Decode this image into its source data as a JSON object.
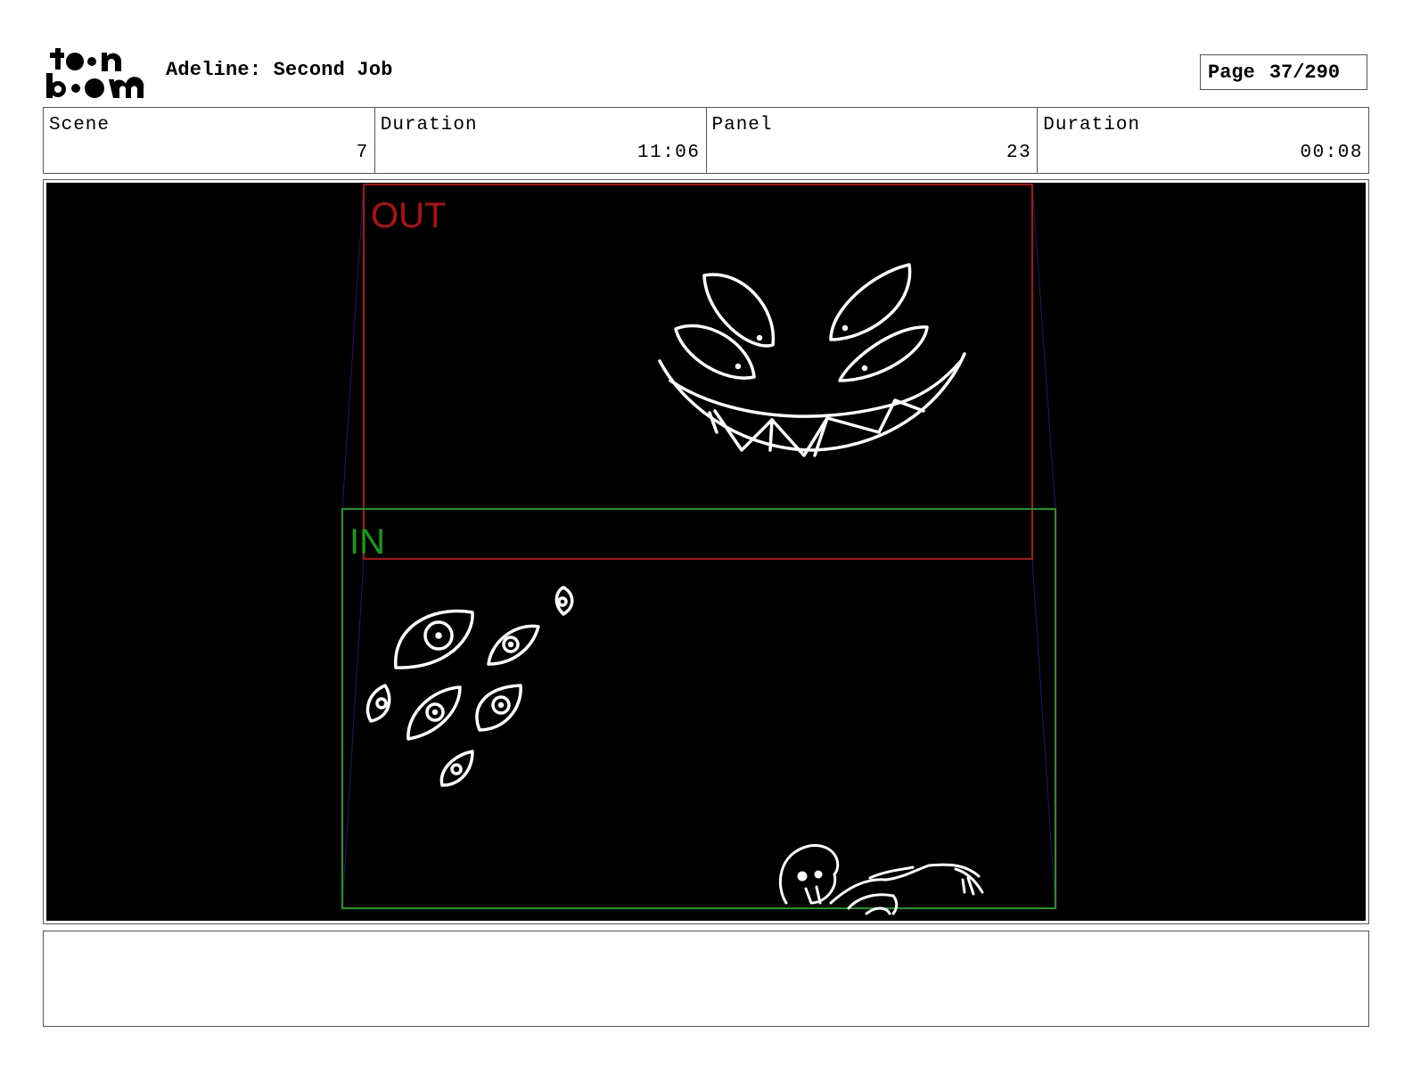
{
  "header": {
    "logo_text": "toonboom",
    "title": "Adeline: Second Job",
    "page_label": "Page",
    "page_value": "37/290"
  },
  "info": [
    {
      "label": "Scene",
      "value": "7"
    },
    {
      "label": "Duration",
      "value": "11:06"
    },
    {
      "label": "Panel",
      "value": "23"
    },
    {
      "label": "Duration",
      "value": "00:08"
    }
  ],
  "panel": {
    "background_color": "#000000",
    "drawing_color": "#ffffff",
    "out_frame": {
      "label": "OUT",
      "color": "#b01010"
    },
    "in_frame": {
      "label": "IN",
      "color": "#1a9a1a"
    }
  },
  "notes": {
    "text": ""
  }
}
